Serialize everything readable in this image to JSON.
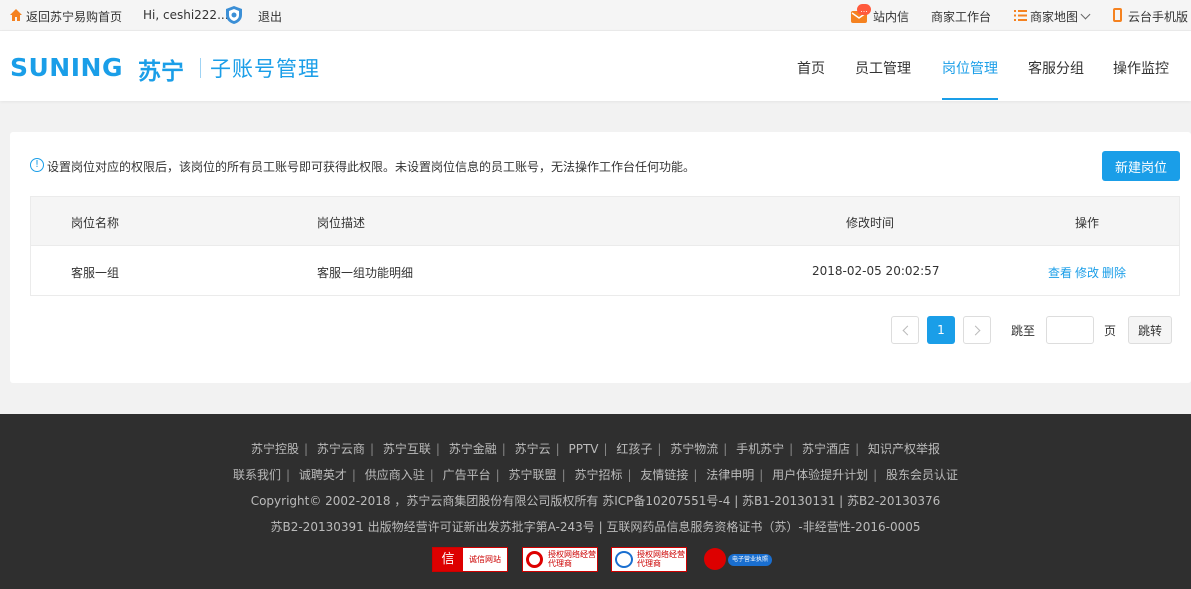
{
  "topbar": {
    "back_home": "返回苏宁易购首页",
    "greeting": "Hi, ceshi222...",
    "logout": "退出",
    "inbox": "站内信",
    "inbox_badge": "...",
    "workbench": "商家工作台",
    "sitemap": "商家地图",
    "mobile": "云台手机版"
  },
  "header": {
    "logo_en": "SUNING",
    "logo_cn": "苏宁",
    "subtitle": "子账号管理",
    "nav": [
      "首页",
      "员工管理",
      "岗位管理",
      "客服分组",
      "操作监控"
    ],
    "active_nav": "岗位管理"
  },
  "main": {
    "notice": "设置岗位对应的权限后，该岗位的所有员工账号即可获得此权限。未设置岗位信息的员工账号，无法操作工作台任何功能。",
    "new_button": "新建岗位",
    "columns": [
      "岗位名称",
      "岗位描述",
      "修改时间",
      "操作"
    ],
    "rows": [
      {
        "name": "客服一组",
        "description": "客服一组功能明细",
        "modified": "2018-02-05 20:02:57",
        "ops": [
          "查看",
          "修改",
          "删除"
        ]
      }
    ],
    "pagination": {
      "current": "1",
      "jump_to": "跳至",
      "page_unit": "页",
      "jump_button": "跳转",
      "jump_value": ""
    }
  },
  "footer": {
    "links_row1": [
      "苏宁控股",
      "苏宁云商",
      "苏宁互联",
      "苏宁金融",
      "苏宁云",
      "PPTV",
      "红孩子",
      "苏宁物流",
      "手机苏宁",
      "苏宁酒店",
      "知识产权举报"
    ],
    "links_row2": [
      "联系我们",
      "诚聘英才",
      "供应商入驻",
      "广告平台",
      "苏宁联盟",
      "苏宁招标",
      "友情链接",
      "法律申明",
      "用户体验提升计划",
      "股东会员认证"
    ],
    "copyright": "Copyright© 2002-2018 ，苏宁云商集团股份有限公司版权所有 苏ICP备10207551号-4 | 苏B1-20130131 | 苏B2-20130376",
    "license": "苏B2-20130391 出版物经营许可证新出发苏批字第A-243号 | 互联网药品信息服务资格证书（苏）-非经营性-2016-0005",
    "badges": [
      "诚信网站",
      "授权网络经营代理商",
      "授权网络经营代理商",
      "电子营业执照"
    ]
  },
  "colors": {
    "brand": "#1a9ee8",
    "accent_orange": "#f58220",
    "footer_bg": "#2f2f2f"
  }
}
